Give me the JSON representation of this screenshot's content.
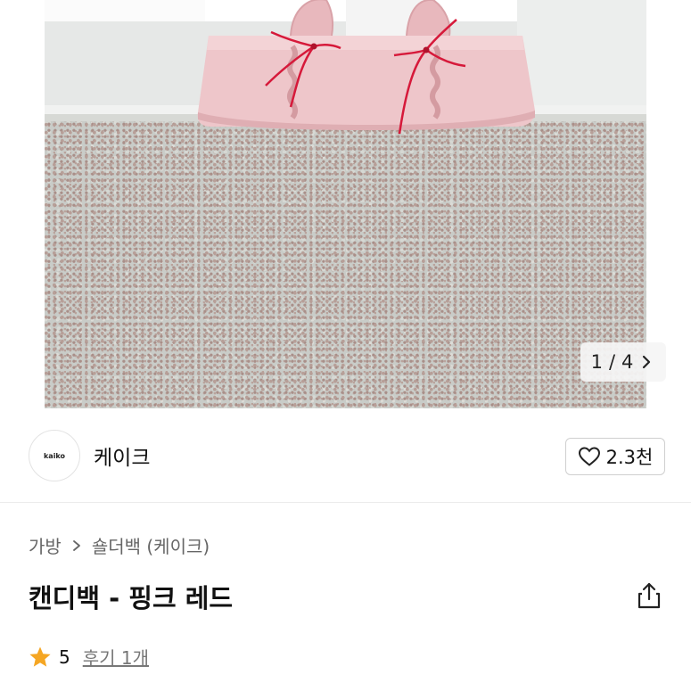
{
  "gallery": {
    "current_page": "1",
    "separator": "/",
    "total_pages": "4",
    "next_icon": "chevron-right-icon"
  },
  "shop": {
    "logo_text": "kaiko",
    "name": "케이크",
    "like_icon": "heart-icon",
    "like_count": "2.3천"
  },
  "breadcrumb": {
    "items": [
      "가방",
      "숄더백 (케이크)"
    ],
    "separator_icon": "chevron-right-icon"
  },
  "product": {
    "title": "캔디백 - 핑크 레드",
    "share_icon": "share-icon"
  },
  "rating": {
    "star_icon": "star-icon",
    "star_color": "#f5a623",
    "score": "5",
    "review_link": "후기 1개"
  }
}
